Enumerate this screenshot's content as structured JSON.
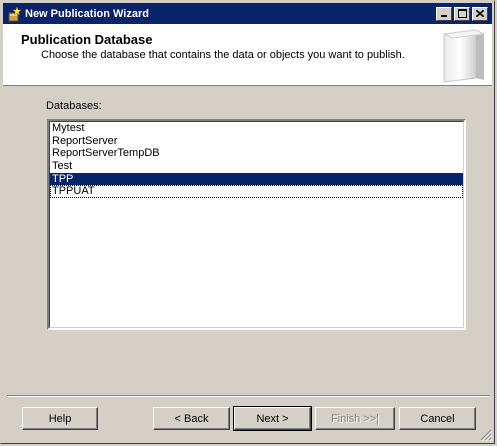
{
  "window": {
    "title": "New Publication Wizard"
  },
  "header": {
    "title": "Publication Database",
    "subtitle": "Choose the database that contains the data or objects you want to publish."
  },
  "databases": {
    "label": "Databases:",
    "items": [
      "Mytest",
      "ReportServer",
      "ReportServerTempDB",
      "Test",
      "TPP",
      "TPPUAT"
    ],
    "selected": "TPP"
  },
  "buttons": {
    "help": "Help",
    "back": "< Back",
    "next": "Next >",
    "finish": "Finish >>|",
    "cancel": "Cancel"
  },
  "colors": {
    "titlebar": "#0a246a",
    "selection": "#0a246a",
    "face": "#d4d0c8"
  },
  "icons": {
    "app": "wizard-icon",
    "minimize": "minimize-icon",
    "maximize": "maximize-icon",
    "close": "close-icon"
  }
}
